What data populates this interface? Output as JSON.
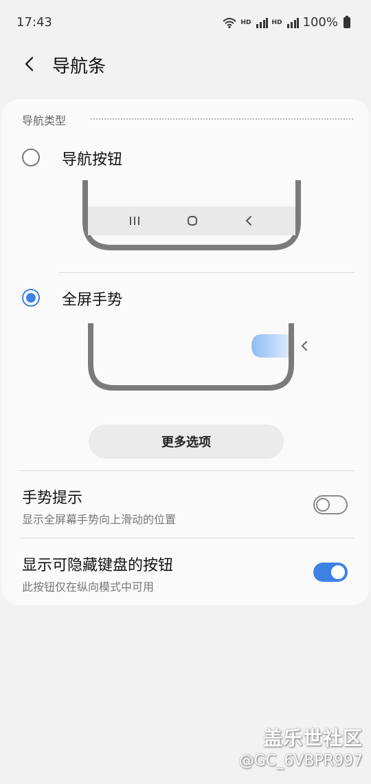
{
  "status_bar": {
    "time": "17:43",
    "signal_1": "HD",
    "signal_2": "HD",
    "battery_percent": "100%"
  },
  "app_bar": {
    "title": "导航条"
  },
  "navigation_type": {
    "header": "导航类型",
    "options": [
      {
        "label": "导航按钮",
        "selected": false
      },
      {
        "label": "全屏手势",
        "selected": true
      }
    ],
    "more_options_label": "更多选项"
  },
  "settings": [
    {
      "title": "手势提示",
      "subtitle": "显示全屏幕手势向上滑动的位置",
      "enabled": false
    },
    {
      "title": "显示可隐藏键盘的按钮",
      "subtitle": "此按钮仅在纵向模式中可用",
      "enabled": true
    }
  ],
  "watermark": {
    "line1": "盖乐世社区",
    "line2": "@GC_6VBPR997"
  },
  "colors": {
    "accent": "#3e82e6",
    "background": "#f2f2f2",
    "card": "#fafafa"
  }
}
